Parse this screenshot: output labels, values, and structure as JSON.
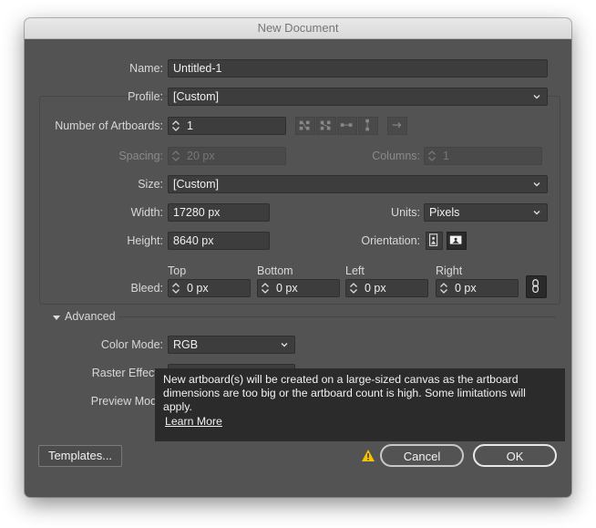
{
  "window": {
    "title": "New Document"
  },
  "fields": {
    "name": {
      "label": "Name:",
      "value": "Untitled-1"
    },
    "profile": {
      "label": "Profile:",
      "value": "[Custom]"
    },
    "artboards": {
      "label": "Number of Artboards:",
      "value": "1"
    },
    "spacing": {
      "label": "Spacing:",
      "value": "20 px"
    },
    "columns": {
      "label": "Columns:",
      "value": "1"
    },
    "size": {
      "label": "Size:",
      "value": "[Custom]"
    },
    "width": {
      "label": "Width:",
      "value": "17280 px"
    },
    "units": {
      "label": "Units:",
      "value": "Pixels"
    },
    "height": {
      "label": "Height:",
      "value": "8640 px"
    },
    "orientation": {
      "label": "Orientation:"
    },
    "bleed": {
      "label": "Bleed:",
      "top_label": "Top",
      "top": "0 px",
      "bottom_label": "Bottom",
      "bottom": "0 px",
      "left_label": "Left",
      "left": "0 px",
      "right_label": "Right",
      "right": "0 px"
    }
  },
  "advanced": {
    "label": "Advanced",
    "color_mode": {
      "label": "Color Mode:",
      "value": "RGB"
    },
    "raster_effects": {
      "label": "Raster Effects"
    },
    "preview_mode": {
      "label": "Preview Mode"
    }
  },
  "tooltip": {
    "message": "New artboard(s) will be created on a large-sized canvas as the artboard dimensions are too big or the artboard count is high. Some limitations will apply.",
    "link": "Learn More"
  },
  "buttons": {
    "templates": "Templates...",
    "cancel": "Cancel",
    "ok": "OK"
  },
  "colors": {
    "dialog": "#535353",
    "field": "#3d3d3d",
    "tooltip": "#2b2b2b",
    "warning": "#f5c400"
  }
}
